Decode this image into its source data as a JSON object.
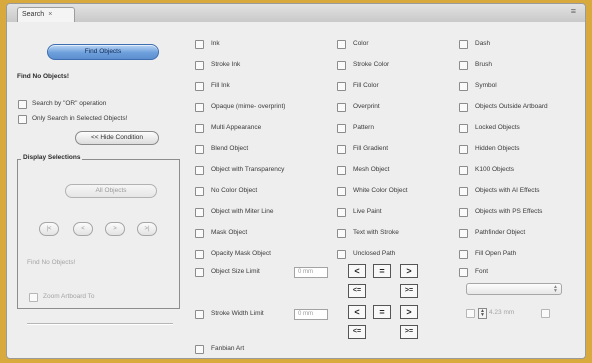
{
  "tab": {
    "label": "Search",
    "close": "×"
  },
  "panel_menu": "≡",
  "left": {
    "find_objects_button": "Find Objects",
    "status": "Find No Objects!",
    "or_search_label": "Search by \"OR\" operation",
    "selected_only_label": "Only Search in Selected Objects!",
    "hide_condition_button": "<< Hide Condition",
    "display_selections": {
      "title": "Display Selections",
      "all_objects_button": "All Objects",
      "nav": {
        "first": "|<",
        "prev": "<",
        "next": ">",
        "last": ">|"
      },
      "status": "Find No Objects!",
      "zoom_label": "Zoom Artboard To"
    }
  },
  "columns": [
    [
      "Ink",
      "Stroke Ink",
      "Fill Ink",
      "Opaque (mime- overprint)",
      "Multi Appearance",
      "Blend Object",
      "Object with Transparency",
      "No Color Object",
      "Object with Miter Line",
      "Mask Object",
      "Opacity Mask Object"
    ],
    [
      "Color",
      "Stroke Color",
      "Fill Color",
      "Overprint",
      "Pattern",
      "Fill Gradient",
      "Mesh Object",
      "White Color Object",
      "Live Paint",
      "Text with Stroke",
      "Unclosed Path"
    ],
    [
      "Dash",
      "Brush",
      "Symbol",
      "Objects Outside Artboard",
      "Locked Objects",
      "Hidden Objects",
      "K100 Objects",
      "Objects with AI Effects",
      "Objects with PS Effects",
      "Pathfinder Object",
      "Fill Open Path"
    ]
  ],
  "object_size_limit": {
    "label": "Object Size Limit",
    "value": "0 mm"
  },
  "stroke_width_limit": {
    "label": "Stroke Width Limit",
    "value": "0 mm"
  },
  "comparators": {
    "lt": "<",
    "eq": "=",
    "gt": ">",
    "le": "<=",
    "ge": ">="
  },
  "font": {
    "label": "Font",
    "size_value": "4.23 mm"
  },
  "fanbian_art_label": "Fanbian Art"
}
